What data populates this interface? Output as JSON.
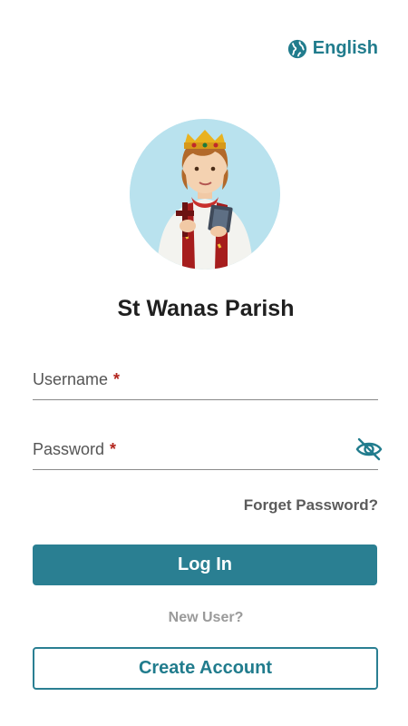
{
  "header": {
    "language_label": "English",
    "language_icon": "globe-icon"
  },
  "parish": {
    "name": "St Wanas Parish",
    "avatar_icon": "saint-avatar"
  },
  "form": {
    "username_label": "Username",
    "password_label": "Password",
    "required_marker": "*",
    "username_value": "",
    "password_value": "",
    "password_visibility_icon": "eye-off-icon",
    "forgot_label": "Forget Password?"
  },
  "actions": {
    "login_label": "Log In",
    "new_user_label": "New User?",
    "create_account_label": "Create Account"
  },
  "colors": {
    "accent": "#2a7f92",
    "required": "#b3261e",
    "avatar_bg": "#b9e2ee"
  }
}
